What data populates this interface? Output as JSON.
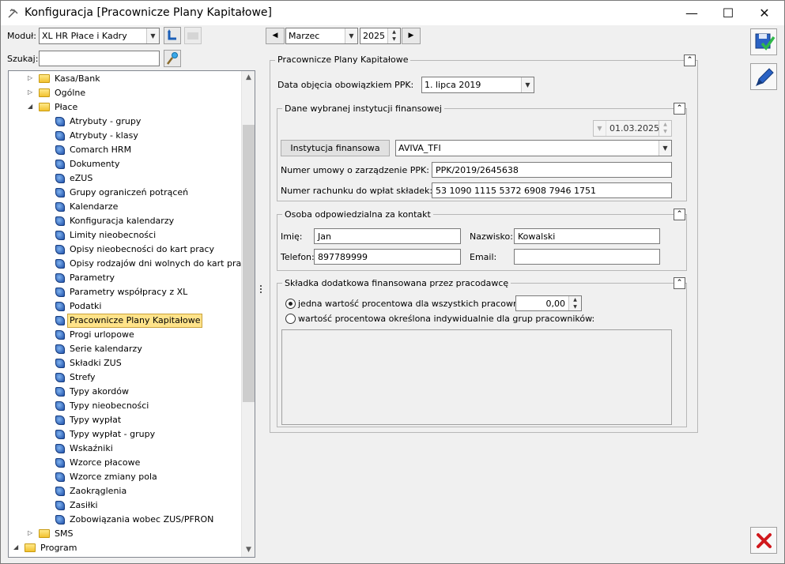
{
  "window": {
    "title": "Konfiguracja [Pracownicze Plany Kapitałowe]",
    "minimize_glyph": "—",
    "maximize_glyph": "☐",
    "close_glyph": "✕"
  },
  "toolbar": {
    "module_label": "Moduł:",
    "module_value": "XL HR Płace i Kadry",
    "search_label": "Szukaj:",
    "search_value": "",
    "month_value": "Marzec",
    "year_value": "2025",
    "prev_glyph": "◀",
    "next_glyph": "▶"
  },
  "tree": {
    "items": [
      {
        "label": "Kasa/Bank",
        "level": 1,
        "kind": "folder",
        "expander": "▷"
      },
      {
        "label": "Ogólne",
        "level": 1,
        "kind": "folder",
        "expander": "▷"
      },
      {
        "label": "Płace",
        "level": 1,
        "kind": "folder",
        "expander": "◢"
      },
      {
        "label": "Atrybuty - grupy",
        "level": 2,
        "kind": "doc"
      },
      {
        "label": "Atrybuty - klasy",
        "level": 2,
        "kind": "doc"
      },
      {
        "label": "Comarch HRM",
        "level": 2,
        "kind": "doc"
      },
      {
        "label": "Dokumenty",
        "level": 2,
        "kind": "doc"
      },
      {
        "label": "eZUS",
        "level": 2,
        "kind": "doc"
      },
      {
        "label": "Grupy ograniczeń potrąceń",
        "level": 2,
        "kind": "doc"
      },
      {
        "label": "Kalendarze",
        "level": 2,
        "kind": "doc"
      },
      {
        "label": "Konfiguracja kalendarzy",
        "level": 2,
        "kind": "doc"
      },
      {
        "label": "Limity nieobecności",
        "level": 2,
        "kind": "doc"
      },
      {
        "label": "Opisy nieobecności do kart pracy",
        "level": 2,
        "kind": "doc"
      },
      {
        "label": "Opisy rodzajów dni wolnych do kart pracy",
        "level": 2,
        "kind": "doc"
      },
      {
        "label": "Parametry",
        "level": 2,
        "kind": "doc"
      },
      {
        "label": "Parametry współpracy z XL",
        "level": 2,
        "kind": "doc"
      },
      {
        "label": "Podatki",
        "level": 2,
        "kind": "doc"
      },
      {
        "label": "Pracownicze Plany Kapitałowe",
        "level": 2,
        "kind": "doc",
        "selected": true
      },
      {
        "label": "Progi urlopowe",
        "level": 2,
        "kind": "doc"
      },
      {
        "label": "Serie kalendarzy",
        "level": 2,
        "kind": "doc"
      },
      {
        "label": "Składki ZUS",
        "level": 2,
        "kind": "doc"
      },
      {
        "label": "Strefy",
        "level": 2,
        "kind": "doc"
      },
      {
        "label": "Typy akordów",
        "level": 2,
        "kind": "doc"
      },
      {
        "label": "Typy nieobecności",
        "level": 2,
        "kind": "doc"
      },
      {
        "label": "Typy wypłat",
        "level": 2,
        "kind": "doc"
      },
      {
        "label": "Typy wypłat - grupy",
        "level": 2,
        "kind": "doc"
      },
      {
        "label": "Wskaźniki",
        "level": 2,
        "kind": "doc"
      },
      {
        "label": "Wzorce płacowe",
        "level": 2,
        "kind": "doc"
      },
      {
        "label": "Wzorce zmiany pola",
        "level": 2,
        "kind": "doc"
      },
      {
        "label": "Zaokrąglenia",
        "level": 2,
        "kind": "doc"
      },
      {
        "label": "Zasiłki",
        "level": 2,
        "kind": "doc"
      },
      {
        "label": "Zobowiązania wobec ZUS/PFRON",
        "level": 2,
        "kind": "doc"
      },
      {
        "label": "SMS",
        "level": 1,
        "kind": "folder",
        "expander": "▷"
      },
      {
        "label": "Program",
        "level": 0,
        "kind": "folder",
        "expander": "◢"
      }
    ]
  },
  "ppk": {
    "group_title": "Pracownicze Plany Kapitałowe",
    "start_date_label": "Data objęcia obowiązkiem PPK:",
    "start_date_value": "1. lipca 2019",
    "institution_group_title": "Dane wybranej instytucji finansowej",
    "institution_date": "01.03.2025",
    "institution_button": "Instytucja finansowa",
    "institution_value": "AVIVA_TFI",
    "contract_label": "Numer umowy o zarządzenie PPK:",
    "contract_value": "PPK/2019/2645638",
    "account_label": "Numer rachunku do wpłat składek:",
    "account_value": "53 1090 1115 5372 6908 7946 1751",
    "contact_group_title": "Osoba odpowiedzialna za kontakt",
    "first_name_label": "Imię:",
    "first_name_value": "Jan",
    "last_name_label": "Nazwisko:",
    "last_name_value": "Kowalski",
    "phone_label": "Telefon:",
    "phone_value": "897789999",
    "email_label": "Email:",
    "email_value": "",
    "extra_group_title": "Składka dodatkowa finansowana przez pracodawcę",
    "radio_all_label": "jedna wartość procentowa dla wszystkich pracowników:",
    "radio_all_value": "0,00",
    "radio_groups_label": "wartość procentowa określona indywidualnie dla grup pracowników:",
    "collapse_glyph": "⌃"
  },
  "colors": {
    "selection": "#ffe38a",
    "folder": "#f2c230",
    "doc_icon": "#1e4fa8",
    "close_red": "#d0181c"
  }
}
